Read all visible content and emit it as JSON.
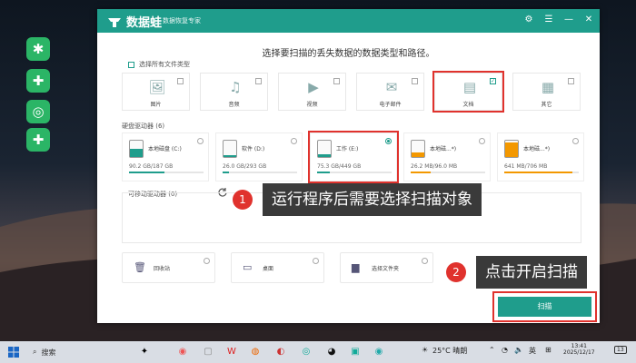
{
  "app": {
    "title": "数据蛙",
    "subtitle": "数据恢复专家",
    "window_buttons": [
      "⚙",
      "☰",
      "—",
      "✕"
    ]
  },
  "heading": "选择要扫描的丢失数据的数据类型和路径。",
  "select_all_label": "选择所有文件类型",
  "file_types": [
    {
      "label": "图片",
      "icon": "image-icon",
      "glyph": "🖼",
      "checked": false,
      "highlighted": false
    },
    {
      "label": "音频",
      "icon": "music-icon",
      "glyph": "♫",
      "checked": false,
      "highlighted": false
    },
    {
      "label": "视频",
      "icon": "video-icon",
      "glyph": "▶",
      "checked": false,
      "highlighted": false
    },
    {
      "label": "电子邮件",
      "icon": "email-icon",
      "glyph": "✉",
      "checked": false,
      "highlighted": false
    },
    {
      "label": "文档",
      "icon": "document-icon",
      "glyph": "▤",
      "checked": true,
      "highlighted": true
    },
    {
      "label": "其它",
      "icon": "other-icon",
      "glyph": "▦",
      "checked": false,
      "highlighted": false
    }
  ],
  "hard_drives_label": "硬盘驱动器",
  "hard_drives_count": "(6)",
  "drives": [
    {
      "name": "本地磁盘 (C:)",
      "size": "90.2 GB/187 GB",
      "usage": 0.48,
      "color": "#1f9d8c",
      "selected": false,
      "highlighted": false
    },
    {
      "name": "软件 (D:)",
      "size": "26.0 GB/293 GB",
      "usage": 0.09,
      "color": "#1f9d8c",
      "selected": false,
      "highlighted": false
    },
    {
      "name": "工作 (E:)",
      "size": "75.3 GB/449 GB",
      "usage": 0.17,
      "color": "#1f9d8c",
      "selected": true,
      "highlighted": true
    },
    {
      "name": "本地磁...*)",
      "size": "26.2 MB/96.0 MB",
      "usage": 0.27,
      "color": "#f39800",
      "selected": false,
      "highlighted": false
    },
    {
      "name": "本地磁...*)",
      "size": "641 MB/706 MB",
      "usage": 0.91,
      "color": "#f39800",
      "selected": false,
      "highlighted": false
    }
  ],
  "removable_label": "可移动驱动器",
  "removable_count": "(0)",
  "locations": [
    {
      "label": "回收站",
      "icon": "recycle-bin-icon",
      "glyph": "🗑"
    },
    {
      "label": "桌面",
      "icon": "desktop-icon",
      "glyph": "▭"
    },
    {
      "label": "选择文件夹",
      "icon": "folder-icon",
      "glyph": "▆"
    }
  ],
  "scan_label": "扫描",
  "annotations": [
    {
      "num": "1",
      "text": "运行程序后需要选择扫描对象"
    },
    {
      "num": "2",
      "text": "点击开启扫描"
    }
  ],
  "taskbar": {
    "search": "搜索",
    "weather": "25°C 晴朗",
    "ime": "英",
    "time": "13:41",
    "date": "2025/12/17",
    "notif": "13"
  }
}
